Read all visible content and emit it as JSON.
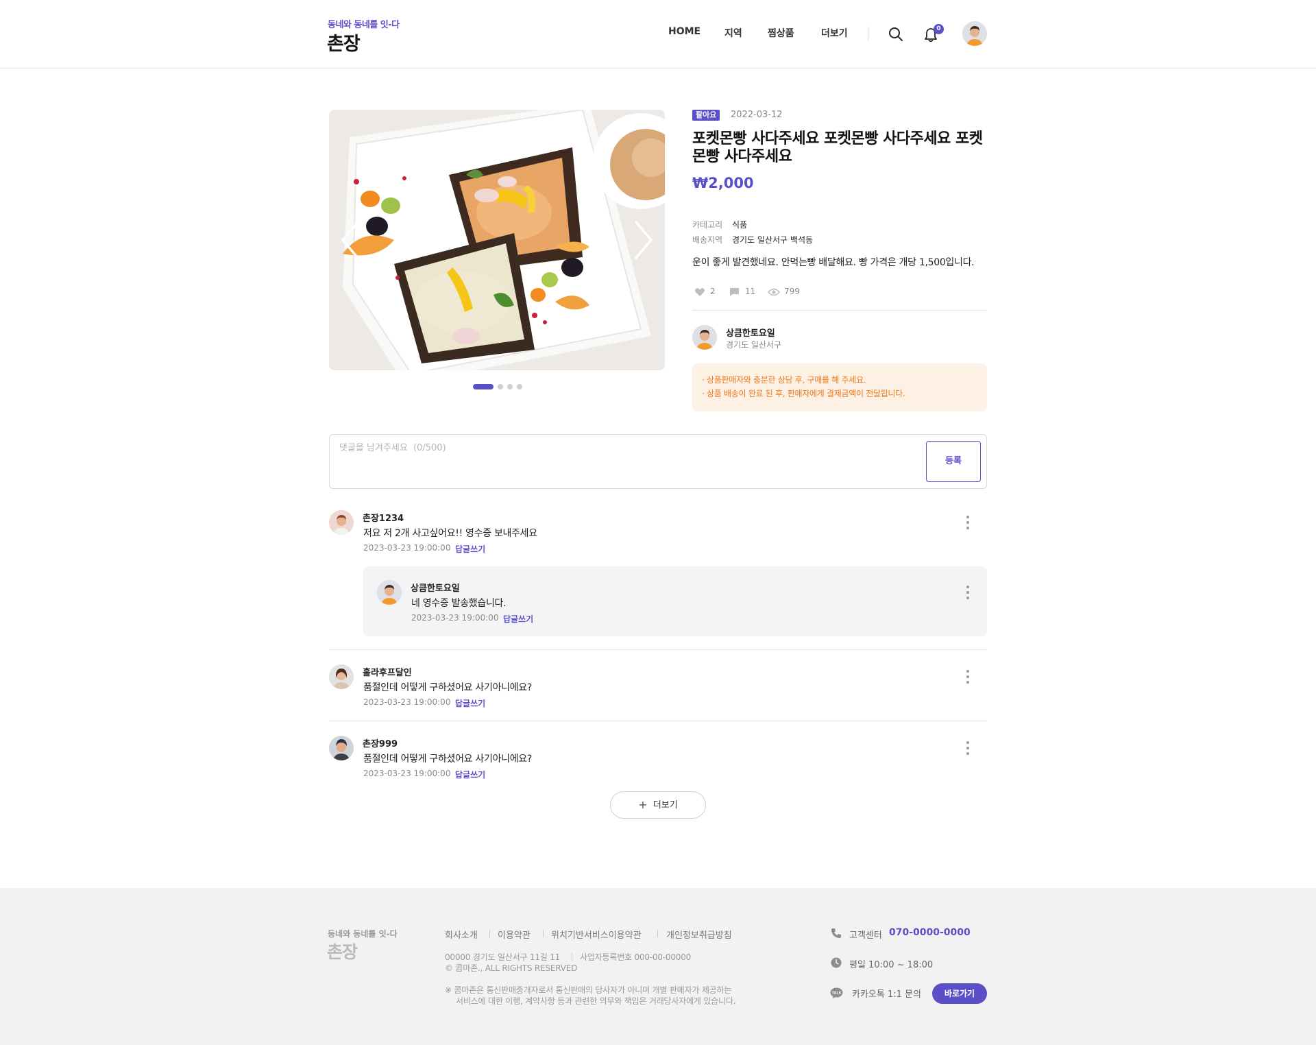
{
  "header": {
    "tagline": "동네와 동네를 잇-다",
    "brand": "촌장",
    "nav": [
      "HOME",
      "지역",
      "찜상품",
      "더보기"
    ],
    "notification_count": "0"
  },
  "product": {
    "badge": "팔아요",
    "date": "2022-03-12",
    "title": "포켓몬빵 사다주세요 포켓몬빵 사다주세요 포켓몬빵 사다주세요",
    "price": "₩2,000",
    "category_label": "카테고리",
    "category_value": "식품",
    "region_label": "배송지역",
    "region_value": "경기도 일산서구 백석동",
    "description": "운이 좋게 발견했네요. 안먹는빵 배달해요. 빵 가격은 개당 1,500입니다.",
    "likes": "2",
    "comments": "11",
    "views": "799",
    "image_slides": 4,
    "active_slide": 1
  },
  "seller": {
    "name": "상큼한토요일",
    "location": "경기도 일산서구"
  },
  "notice": [
    "· 상품판매자와 충분한 상담 후, 구매를 해 주세요.",
    "· 상품 배송이 완료 된 후, 판매자에게 결제금액이 전달됩니다."
  ],
  "comment_form": {
    "placeholder": "댓글을 남겨주세요  (0/500)",
    "submit": "등록"
  },
  "comments": [
    {
      "name": "촌장1234",
      "text": "저요 저 2개 사고싶어요!! 영수증 보내주세요",
      "date": "2023-03-23 19:00:00",
      "reply": "답글쓰기"
    },
    {
      "name": "상큼한토요일",
      "text": "네 영수증 발송했습니다.",
      "date": "2023-03-23 19:00:00",
      "reply": "답글쓰기"
    },
    {
      "name": "훌라후프달인",
      "text": "품절인데 어떻게 구하셨어요 사기아니에요?",
      "date": "2023-03-23 19:00:00",
      "reply": "답글쓰기"
    },
    {
      "name": "촌장999",
      "text": "품절인데 어떻게 구하셨어요 사기아니에요?",
      "date": "2023-03-23 19:00:00",
      "reply": "답글쓰기"
    }
  ],
  "more_label": "더보기",
  "footer": {
    "tagline": "동네와 동네를 잇-다",
    "brand": "촌장",
    "links": [
      "회사소개",
      "이용약관",
      "위치기반서비스이용약관",
      "개인정보취급방침"
    ],
    "address": "00000 경기도 일산서구 11길 11",
    "business_no": "사업자등록번호 000-00-00000",
    "copyright": "© 콤마존., ALL RIGHTS RESERVED",
    "disclaimer_1": "※ 콤마존은 통신판매중개자로서 통신판매의 당사자가 아니며 개별 판매자가 제공하는",
    "disclaimer_2": "서비스에 대한  이행, 계약사항 등과 관련한 의무와 책임은 거래당사자에게 있습니다.",
    "cs_label": "고객센터",
    "cs_phone": "070-0000-0000",
    "hours": "평일 10:00 ~ 18:00",
    "kakao_label": "카카오톡 1:1 문의",
    "kakao_button": "바로가기",
    "kakao_icon_text": "TALK"
  },
  "colors": {
    "accent": "#5b4fc7",
    "notice_text": "#ef7a1a",
    "notice_bg": "#fdf0e5",
    "footer_bg": "#f2f2f2"
  },
  "icons": [
    "search-icon",
    "bell-icon",
    "heart-icon",
    "comment-icon",
    "eye-icon",
    "phone-icon",
    "clock-icon",
    "kakao-talk-icon",
    "plus-icon",
    "kebab-icon",
    "chevron-left-icon",
    "chevron-right-icon"
  ]
}
